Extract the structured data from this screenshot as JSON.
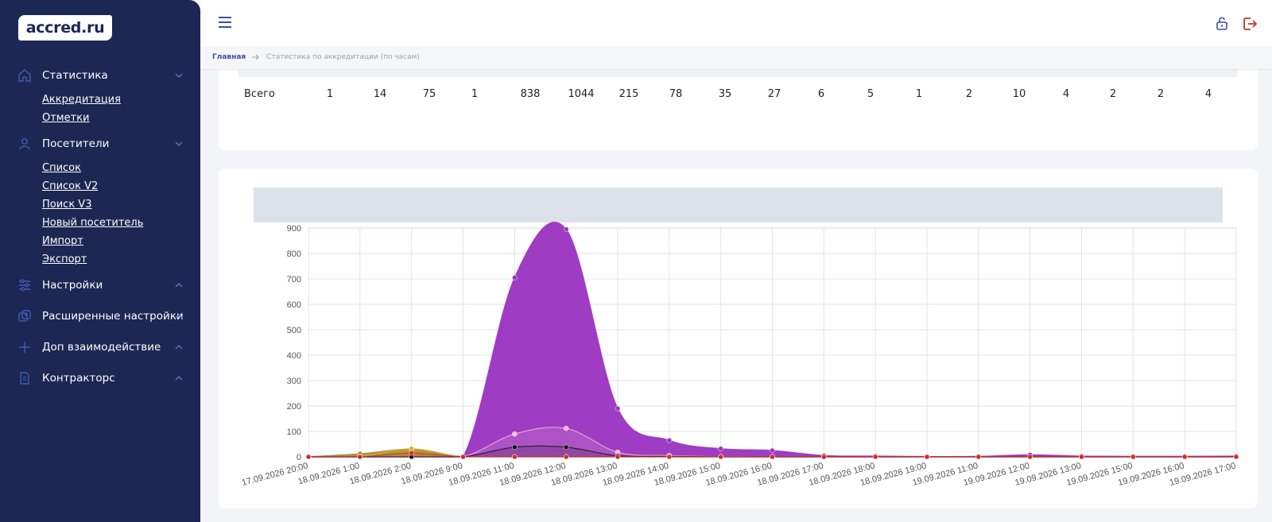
{
  "brand": {
    "logo_text": "accred.ru"
  },
  "sidebar": {
    "sections": [
      {
        "label": "Статистика",
        "icon": "home-icon",
        "expanded": true
      },
      {
        "label": "Посетители",
        "icon": "user-icon",
        "expanded": true
      },
      {
        "label": "Настройки",
        "icon": "sliders-icon",
        "expanded": false
      },
      {
        "label": "Расширенные настройки",
        "icon": "advanced-settings-icon",
        "expanded": false
      },
      {
        "label": "Доп взаимодействие",
        "icon": "plus-icon",
        "expanded": false
      },
      {
        "label": "Контракторс",
        "icon": "document-icon",
        "expanded": false
      }
    ],
    "stats_links": [
      "Аккредитация",
      "Отметки"
    ],
    "visitors_links": [
      "Список",
      "Список V2",
      "Поиск V3",
      "Новый посетитель",
      "Импорт",
      "Экспорт"
    ]
  },
  "header": {
    "menu_icon": "hamburger-icon",
    "lock_icon": "lock-icon",
    "logout_icon": "logout-icon"
  },
  "breadcrumb": {
    "home": "Главная",
    "separator_icon": "arrow-right-icon",
    "current": "Статистика по аккредитации (по часам)"
  },
  "totals": {
    "label": "Всего",
    "values": [
      "1",
      "14",
      "75",
      "1",
      "838",
      "1044",
      "215",
      "78",
      "35",
      "27",
      "6",
      "5",
      "1",
      "2",
      "10",
      "4",
      "2",
      "2",
      "4"
    ]
  },
  "colors": {
    "sidebar_bg": "#1c2753",
    "accent": "#3a4ea8",
    "logout": "#d0302a",
    "series_main": "#9933c0",
    "series_olive": "#9a8a2a"
  },
  "chart_data": {
    "type": "area",
    "categories": [
      "17.09.2026 20:00",
      "18.09.2026 1:00",
      "18.09.2026 2:00",
      "18.09.2026 9:00",
      "18.09.2026 11:00",
      "18.09.2026 12:00",
      "18.09.2026 13:00",
      "18.09.2026 14:00",
      "18.09.2026 15:00",
      "18.09.2026 16:00",
      "18.09.2026 17:00",
      "18.09.2026 18:00",
      "18.09.2026 19:00",
      "19.09.2026 11:00",
      "19.09.2026 12:00",
      "19.09.2026 13:00",
      "19.09.2026 15:00",
      "19.09.2026 16:00",
      "19.09.2026 17:00"
    ],
    "ylim": [
      0,
      900
    ],
    "yticks": [
      0,
      100,
      200,
      300,
      400,
      500,
      600,
      700,
      800,
      900
    ],
    "grid": true,
    "series": [
      {
        "color": "#9933c0",
        "values": [
          0,
          0,
          0,
          0,
          705,
          895,
          190,
          65,
          32,
          25,
          5,
          3,
          1,
          2,
          8,
          3,
          2,
          2,
          3
        ]
      },
      {
        "color": "#9a8a2a",
        "values": [
          1,
          12,
          30,
          1,
          0,
          0,
          0,
          0,
          0,
          0,
          0,
          0,
          0,
          0,
          0,
          0,
          0,
          0,
          0
        ]
      },
      {
        "color": "#f2b8d8",
        "values": [
          0,
          0,
          0,
          0,
          90,
          112,
          18,
          5,
          1,
          0,
          0,
          0,
          0,
          0,
          0,
          0,
          0,
          0,
          0
        ]
      },
      {
        "color": "#111111",
        "values": [
          0,
          0,
          0,
          0,
          38,
          38,
          4,
          2,
          0,
          0,
          0,
          0,
          0,
          0,
          0,
          0,
          0,
          0,
          0
        ]
      },
      {
        "color": "#d12a2a",
        "values": [
          0,
          0,
          15,
          0,
          0,
          0,
          0,
          0,
          0,
          0,
          0,
          0,
          0,
          0,
          0,
          0,
          0,
          0,
          0
        ]
      },
      {
        "color": "#e0b030",
        "values": [
          0,
          2,
          32,
          0,
          0,
          0,
          0,
          0,
          0,
          0,
          0,
          0,
          0,
          0,
          0,
          0,
          0,
          0,
          0
        ]
      }
    ]
  }
}
